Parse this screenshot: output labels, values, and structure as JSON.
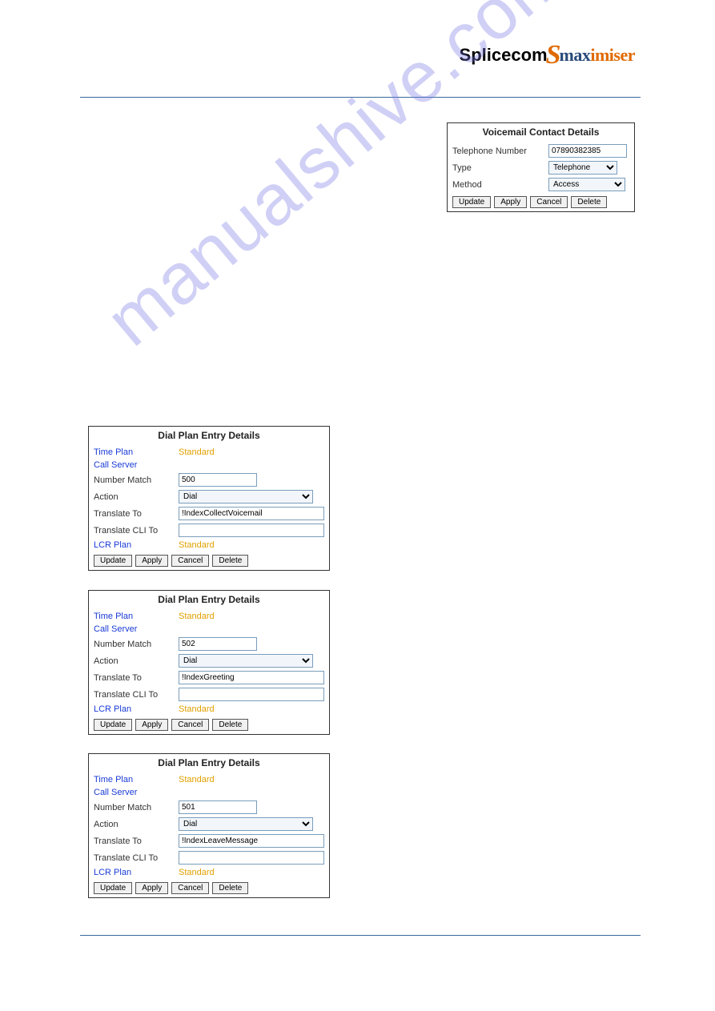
{
  "logo": {
    "p1": "Splice",
    "p2": "com",
    "s": "S",
    "p3": "max",
    "p4": "imiser"
  },
  "watermark": "manualshive.com",
  "voicemail": {
    "title": "Voicemail Contact Details",
    "telLabel": "Telephone Number",
    "telValue": "07890382385",
    "typeLabel": "Type",
    "typeValue": "Telephone",
    "methodLabel": "Method",
    "methodValue": "Access",
    "update": "Update",
    "apply": "Apply",
    "cancel": "Cancel",
    "delete": "Delete"
  },
  "dial": {
    "title": "Dial Plan Entry Details",
    "timePlan": "Time Plan",
    "callServer": "Call Server",
    "numberMatch": "Number Match",
    "action": "Action",
    "translateTo": "Translate To",
    "translateCli": "Translate CLI To",
    "lcrPlan": "LCR Plan",
    "standard": "Standard",
    "dialOption": "Dial",
    "update": "Update",
    "apply": "Apply",
    "cancel": "Cancel",
    "delete": "Delete"
  },
  "entries": [
    {
      "numberMatch": "500",
      "translateTo": "!IndexCollectVoicemail",
      "translateCli": ""
    },
    {
      "numberMatch": "502",
      "translateTo": "!IndexGreeting",
      "translateCli": ""
    },
    {
      "numberMatch": "501",
      "translateTo": "!IndexLeaveMessage",
      "translateCli": ""
    }
  ]
}
